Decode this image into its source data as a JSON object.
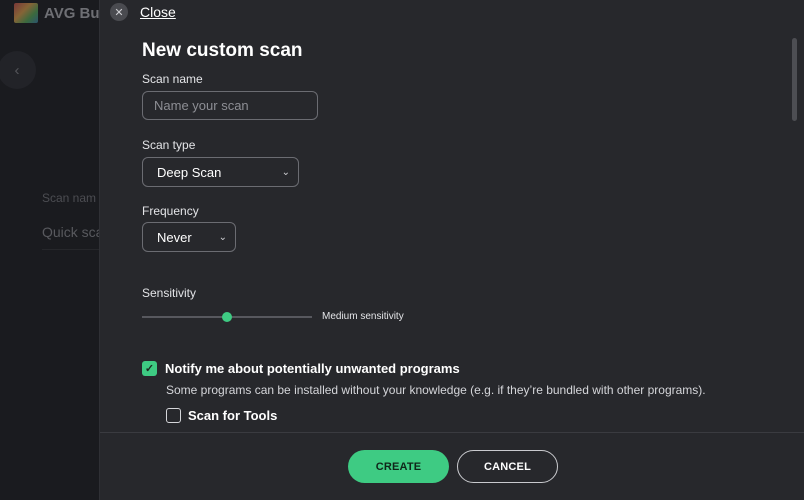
{
  "background_app": {
    "logo_text": "AVG Bu",
    "back_icon": "chevron-left-icon",
    "scan_name_label": "Scan nam",
    "scan_name_value": "Quick sca"
  },
  "panel": {
    "close_label": "Close",
    "title": "New custom scan",
    "scan_name": {
      "label": "Scan name",
      "placeholder": "Name your scan",
      "value": ""
    },
    "scan_type": {
      "label": "Scan type",
      "selected": "Deep Scan"
    },
    "frequency": {
      "label": "Frequency",
      "selected": "Never"
    },
    "sensitivity": {
      "label": "Sensitivity",
      "value_text": "Medium sensitivity",
      "level": 0.5
    },
    "pup": {
      "label": "Notify me about potentially unwanted programs",
      "checked": true,
      "description": "Some programs can be installed without your knowledge (e.g. if they’re bundled with other programs)."
    },
    "scan_tools": {
      "label": "Scan for Tools",
      "checked": false
    }
  },
  "footer": {
    "create_label": "CREATE",
    "cancel_label": "CANCEL"
  },
  "colors": {
    "accent": "#3ecb83",
    "panel_bg": "#27282c",
    "page_bg": "#16171b"
  }
}
